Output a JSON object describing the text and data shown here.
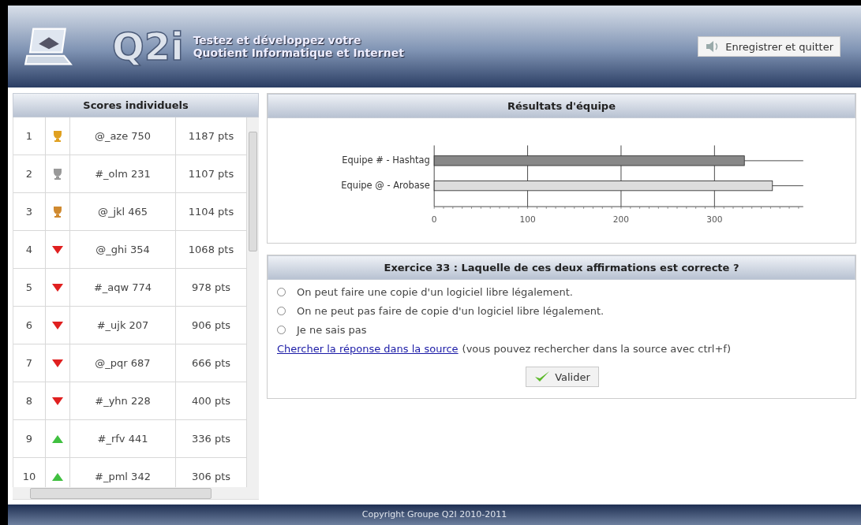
{
  "header": {
    "logo_text": "Q2i",
    "tagline_line_1": "Testez et développez votre",
    "tagline_line_2": "Quotient Informatique et Internet",
    "button": "Enregistrer et quitter"
  },
  "scores": {
    "title": "Scores individuels",
    "rows": [
      {
        "rank": "1",
        "kind": "gold",
        "name": "@_aze 750",
        "points": "1187 pts"
      },
      {
        "rank": "2",
        "kind": "silver",
        "name": "#_olm 231",
        "points": "1107 pts"
      },
      {
        "rank": "3",
        "kind": "bronze",
        "name": "@_jkl 465",
        "points": "1104 pts"
      },
      {
        "rank": "4",
        "kind": "down",
        "name": "@_ghi 354",
        "points": "1068 pts"
      },
      {
        "rank": "5",
        "kind": "down",
        "name": "#_aqw 774",
        "points": "978 pts"
      },
      {
        "rank": "6",
        "kind": "down",
        "name": "#_ujk 207",
        "points": "906 pts"
      },
      {
        "rank": "7",
        "kind": "down",
        "name": "@_pqr 687",
        "points": "666 pts"
      },
      {
        "rank": "8",
        "kind": "down",
        "name": "#_yhn 228",
        "points": "400 pts"
      },
      {
        "rank": "9",
        "kind": "up",
        "name": "#_rfv 441",
        "points": "336 pts"
      },
      {
        "rank": "10",
        "kind": "up",
        "name": "#_pml 342",
        "points": "306 pts"
      }
    ]
  },
  "team_results": {
    "title": "Résultats d'équipe",
    "chart_data": {
      "type": "bar",
      "orientation": "horizontal",
      "categories": [
        "Equipe # - Hashtag",
        "Equipe @ - Arobase"
      ],
      "series": [
        {
          "values": [
            332,
            362
          ],
          "errors": [
            63,
            33
          ]
        }
      ],
      "xlim": [
        0,
        395
      ],
      "xticks": [
        0,
        100,
        200,
        300
      ],
      "grid": true
    }
  },
  "exercise": {
    "title": "Exercice 33 : Laquelle de ces deux affirmations est correcte ?",
    "options": [
      {
        "label": "On peut faire une copie d'un logiciel libre légalement.",
        "selected": false
      },
      {
        "label": "On ne peut pas faire de copie d'un logiciel libre légalement.",
        "selected": false
      },
      {
        "label": "Je ne sais pas",
        "selected": false
      }
    ],
    "link": "Chercher la réponse dans la source",
    "hint": "(vous pouvez rechercher dans la source avec ctrl+f)",
    "button": "Valider"
  },
  "footer": "Copyright Groupe Q2I 2010-2011"
}
